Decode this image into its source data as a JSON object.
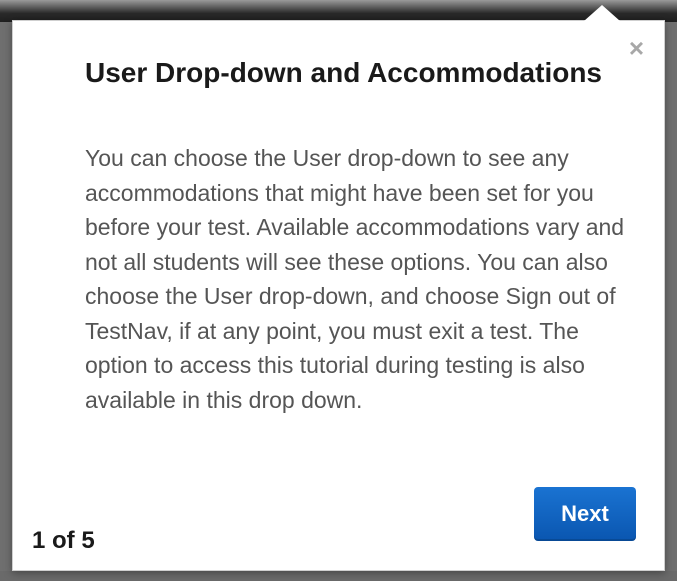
{
  "popover": {
    "title": "User Drop-down and Accommodations",
    "body": "You can choose the User drop-down to see any accommodations that might have been set for you before your test. Available accommodations vary and not all students will see these options. You can also choose the User drop-down, and choose Sign out of TestNav, if at any point, you must exit a test. The option to access this tutorial during testing is also available in this drop down.",
    "close_label": "×",
    "next_label": "Next",
    "step_counter": "1 of 5"
  },
  "colors": {
    "accent": "#0a62c4",
    "title_text": "#1a1a1a",
    "body_text": "#555555",
    "close_icon": "#a8a8a8"
  },
  "icons": {
    "close": "close-icon"
  }
}
